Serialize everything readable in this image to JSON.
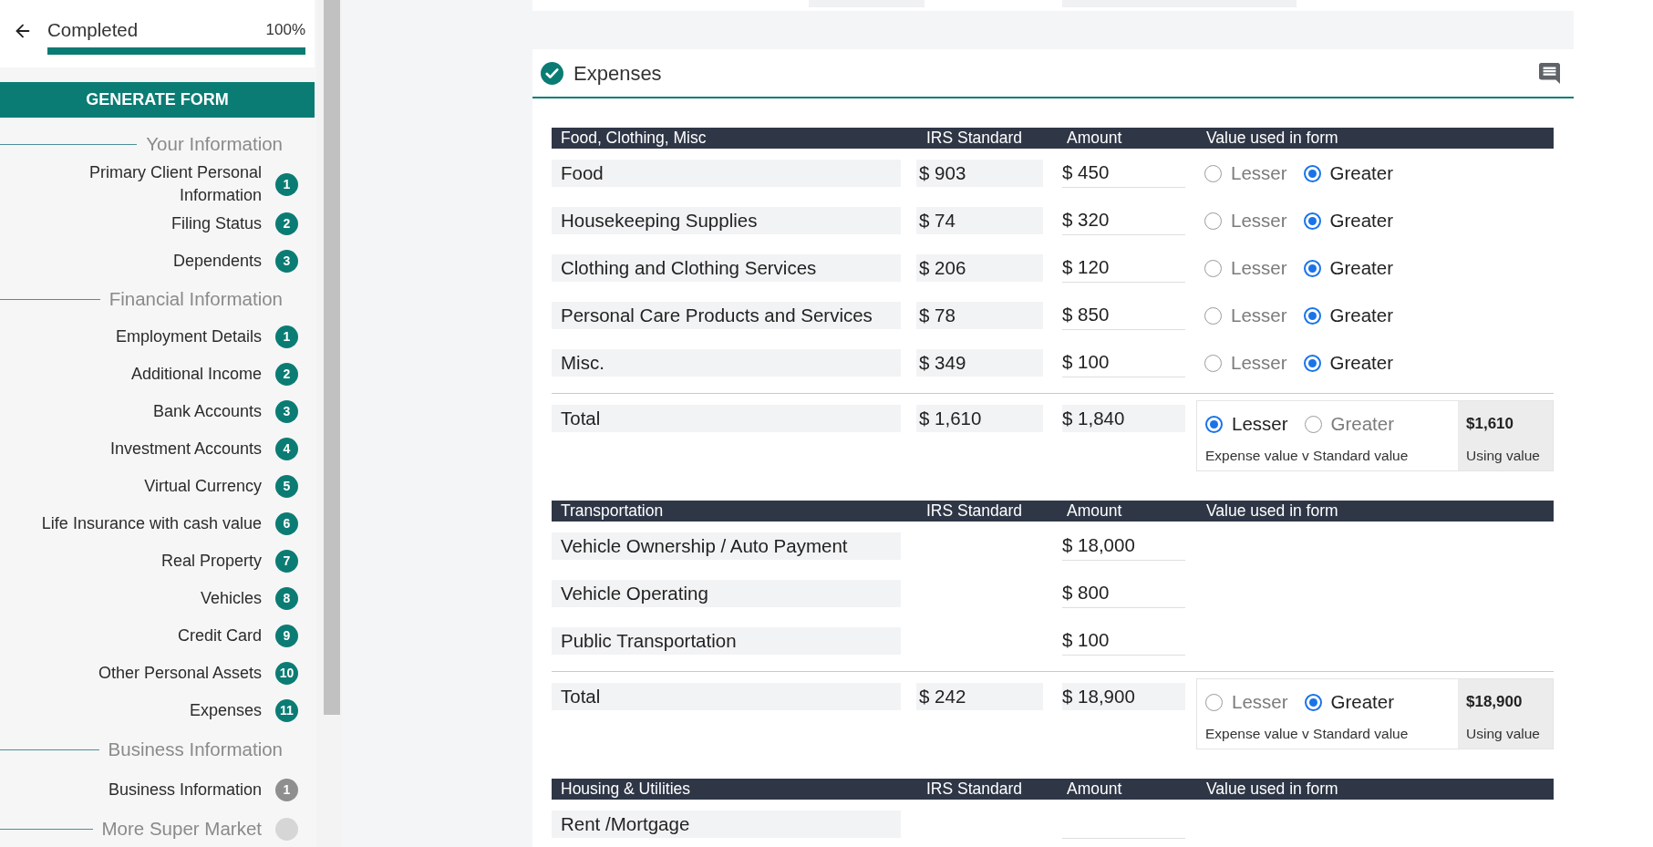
{
  "sidebar": {
    "progress": {
      "label": "Completed",
      "percent": "100%",
      "level": 1
    },
    "generate_button": "GENERATE FORM",
    "sections": [
      {
        "title": "Your Information",
        "badge": false,
        "items": [
          {
            "label": "Primary Client Personal Information",
            "number": "1",
            "done": true
          },
          {
            "label": "Filing Status",
            "number": "2",
            "done": true
          },
          {
            "label": "Dependents",
            "number": "3",
            "done": true
          }
        ]
      },
      {
        "title": "Financial Information",
        "badge": false,
        "items": [
          {
            "label": "Employment Details",
            "number": "1",
            "done": true
          },
          {
            "label": "Additional Income",
            "number": "2",
            "done": true
          },
          {
            "label": "Bank Accounts",
            "number": "3",
            "done": true
          },
          {
            "label": "Investment Accounts",
            "number": "4",
            "done": true
          },
          {
            "label": "Virtual Currency",
            "number": "5",
            "done": true
          },
          {
            "label": "Life Insurance with cash value",
            "number": "6",
            "done": true
          },
          {
            "label": "Real Property",
            "number": "7",
            "done": true
          },
          {
            "label": "Vehicles",
            "number": "8",
            "done": true
          },
          {
            "label": "Credit Card",
            "number": "9",
            "done": true
          },
          {
            "label": "Other Personal Assets",
            "number": "10",
            "done": true
          },
          {
            "label": "Expenses",
            "number": "11",
            "done": true
          }
        ]
      },
      {
        "title": "Business Information",
        "badge": false,
        "items": [
          {
            "label": "Business Information",
            "number": "1",
            "done": false
          }
        ]
      },
      {
        "title": "More Super Market",
        "badge": true
      }
    ]
  },
  "expenses": {
    "title": "Expenses",
    "complete": true,
    "groups": [
      {
        "columns": [
          "Food, Clothing, Misc",
          "IRS Standard",
          "Amount",
          "Value used in form"
        ],
        "rows": [
          {
            "label": "Food",
            "irs": "$ 903",
            "amount": "$ 450",
            "options": [
              {
                "label": "Lesser",
                "selected": false
              },
              {
                "label": "Greater",
                "selected": true
              }
            ]
          },
          {
            "label": "Housekeeping Supplies",
            "irs": "$ 74",
            "amount": "$ 320",
            "options": [
              {
                "label": "Lesser",
                "selected": false
              },
              {
                "label": "Greater",
                "selected": true
              }
            ]
          },
          {
            "label": "Clothing and Clothing Services",
            "irs": "$ 206",
            "amount": "$ 120",
            "options": [
              {
                "label": "Lesser",
                "selected": false
              },
              {
                "label": "Greater",
                "selected": true
              }
            ]
          },
          {
            "label": "Personal Care Products and Services",
            "irs": "$ 78",
            "amount": "$ 850",
            "options": [
              {
                "label": "Lesser",
                "selected": false
              },
              {
                "label": "Greater",
                "selected": true
              }
            ]
          },
          {
            "label": "Misc.",
            "irs": "$ 349",
            "amount": "$ 100",
            "options": [
              {
                "label": "Lesser",
                "selected": false
              },
              {
                "label": "Greater",
                "selected": true
              }
            ]
          }
        ],
        "total": {
          "label": "Total",
          "irs": "$ 1,610",
          "amount": "$ 1,840",
          "options": [
            {
              "label": "Lesser",
              "selected": true
            },
            {
              "label": "Greater",
              "selected": false
            }
          ],
          "caption": "Expense value v Standard value",
          "using_value": "$1,610",
          "using_caption": "Using value"
        }
      },
      {
        "columns": [
          "Transportation",
          "IRS Standard",
          "Amount",
          "Value used in form"
        ],
        "rows": [
          {
            "label": "Vehicle Ownership / Auto Payment",
            "amount": "$ 18,000"
          },
          {
            "label": "Vehicle Operating",
            "amount": "$ 800"
          },
          {
            "label": "Public Transportation",
            "amount": "$ 100"
          }
        ],
        "total": {
          "label": "Total",
          "irs": "$ 242",
          "amount": "$ 18,900",
          "options": [
            {
              "label": "Lesser",
              "selected": false
            },
            {
              "label": "Greater",
              "selected": true
            }
          ],
          "caption": "Expense value v Standard value",
          "using_value": "$18,900",
          "using_caption": "Using value"
        }
      },
      {
        "columns": [
          "Housing & Utilities",
          "IRS Standard",
          "Amount",
          "Value used in form"
        ],
        "rows": [
          {
            "label": "Rent /Mortgage"
          }
        ]
      }
    ]
  }
}
